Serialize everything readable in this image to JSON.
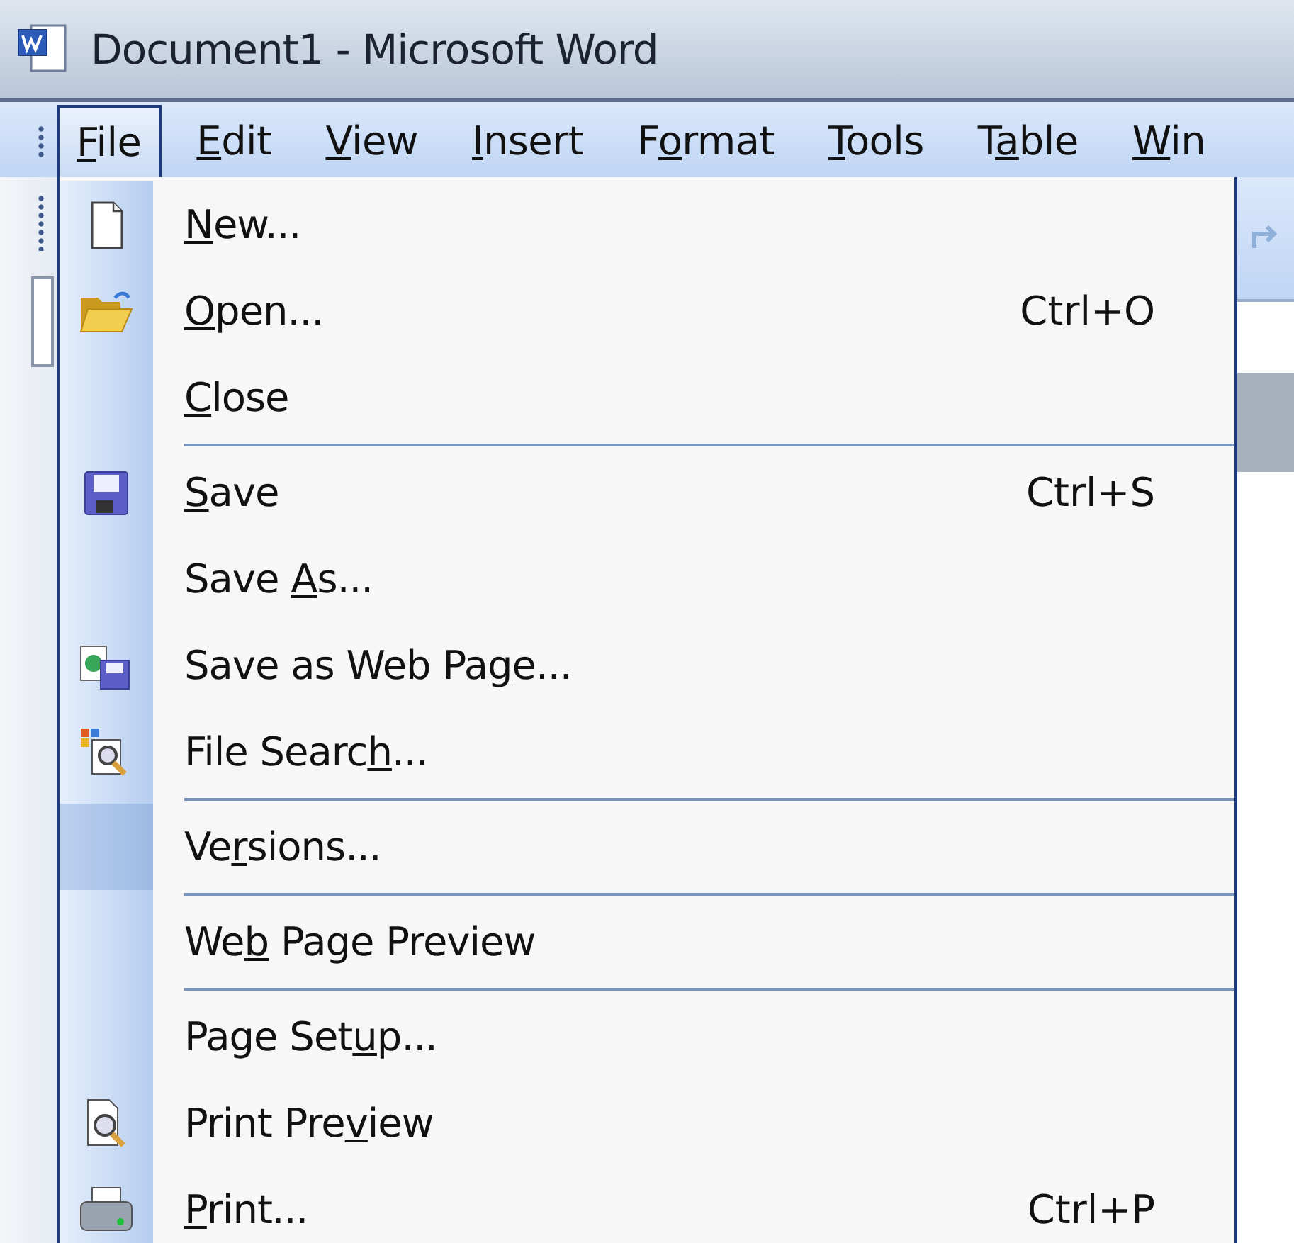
{
  "window": {
    "title": "Document1 - Microsoft Word"
  },
  "menu_bar": [
    {
      "label_parts": [
        {
          "text": "F",
          "underlined": true
        },
        {
          "text": "ile",
          "underlined": false
        }
      ],
      "selected": true
    },
    {
      "label_parts": [
        {
          "text": "E",
          "underlined": true
        },
        {
          "text": "dit",
          "underlined": false
        }
      ],
      "selected": false
    },
    {
      "label_parts": [
        {
          "text": "V",
          "underlined": true
        },
        {
          "text": "iew",
          "underlined": false
        }
      ],
      "selected": false
    },
    {
      "label_parts": [
        {
          "text": "I",
          "underlined": true
        },
        {
          "text": "nsert",
          "underlined": false
        }
      ],
      "selected": false
    },
    {
      "label_parts": [
        {
          "text": "F",
          "underlined": false
        },
        {
          "text": "o",
          "underlined": true
        },
        {
          "text": "rmat",
          "underlined": false
        }
      ],
      "selected": false
    },
    {
      "label_parts": [
        {
          "text": "T",
          "underlined": true
        },
        {
          "text": "ools",
          "underlined": false
        }
      ],
      "selected": false
    },
    {
      "label_parts": [
        {
          "text": "T",
          "underlined": false
        },
        {
          "text": "a",
          "underlined": true
        },
        {
          "text": "ble",
          "underlined": false
        }
      ],
      "selected": false
    },
    {
      "label_parts": [
        {
          "text": "W",
          "underlined": true
        },
        {
          "text": "in",
          "underlined": false
        }
      ],
      "selected": false
    }
  ],
  "file_menu": [
    {
      "kind": "command",
      "label_parts": [
        {
          "text": "N",
          "underlined": true
        },
        {
          "text": "ew...",
          "underlined": false
        }
      ],
      "rarely_used": false
    },
    {
      "kind": "command",
      "label_parts": [
        {
          "text": "O",
          "underlined": true
        },
        {
          "text": "pen...",
          "underlined": false
        }
      ],
      "shortcut": "Ctrl+O",
      "rarely_used": false
    },
    {
      "kind": "command",
      "label_parts": [
        {
          "text": "C",
          "underlined": true
        },
        {
          "text": "lose",
          "underlined": false
        }
      ],
      "rarely_used": false
    },
    {
      "kind": "separator"
    },
    {
      "kind": "command",
      "label_parts": [
        {
          "text": "S",
          "underlined": true
        },
        {
          "text": "ave",
          "underlined": false
        }
      ],
      "shortcut": "Ctrl+S",
      "rarely_used": false
    },
    {
      "kind": "command",
      "label_parts": [
        {
          "text": "Save ",
          "underlined": false
        },
        {
          "text": "A",
          "underlined": true
        },
        {
          "text": "s...",
          "underlined": false
        }
      ],
      "rarely_used": false
    },
    {
      "kind": "command",
      "label_parts": [
        {
          "text": "Save as Web Pa",
          "underlined": false
        },
        {
          "text": "g",
          "underlined": true
        },
        {
          "text": "e...",
          "underlined": false
        }
      ],
      "rarely_used": false
    },
    {
      "kind": "command",
      "label_parts": [
        {
          "text": "File Searc",
          "underlined": false
        },
        {
          "text": "h",
          "underlined": true
        },
        {
          "text": "...",
          "underlined": false
        }
      ],
      "rarely_used": false
    },
    {
      "kind": "separator"
    },
    {
      "kind": "command",
      "label_parts": [
        {
          "text": "Ve",
          "underlined": false
        },
        {
          "text": "r",
          "underlined": true
        },
        {
          "text": "sions...",
          "underlined": false
        }
      ],
      "rarely_used": true
    },
    {
      "kind": "separator"
    },
    {
      "kind": "command",
      "label_parts": [
        {
          "text": "We",
          "underlined": false
        },
        {
          "text": "b",
          "underlined": true
        },
        {
          "text": " Page Preview",
          "underlined": false
        }
      ],
      "rarely_used": false
    },
    {
      "kind": "separator"
    },
    {
      "kind": "command",
      "label_parts": [
        {
          "text": "Page Set",
          "underlined": false
        },
        {
          "text": "u",
          "underlined": true
        },
        {
          "text": "p...",
          "underlined": false
        }
      ],
      "rarely_used": false
    },
    {
      "kind": "command",
      "label_parts": [
        {
          "text": "Print Pre",
          "underlined": false
        },
        {
          "text": "v",
          "underlined": true
        },
        {
          "text": "iew",
          "underlined": false
        }
      ],
      "rarely_used": false
    },
    {
      "kind": "command",
      "label_parts": [
        {
          "text": "P",
          "underlined": true
        },
        {
          "text": "rint...",
          "underlined": false
        }
      ],
      "shortcut": "Ctrl+P",
      "rarely_used": false
    }
  ]
}
